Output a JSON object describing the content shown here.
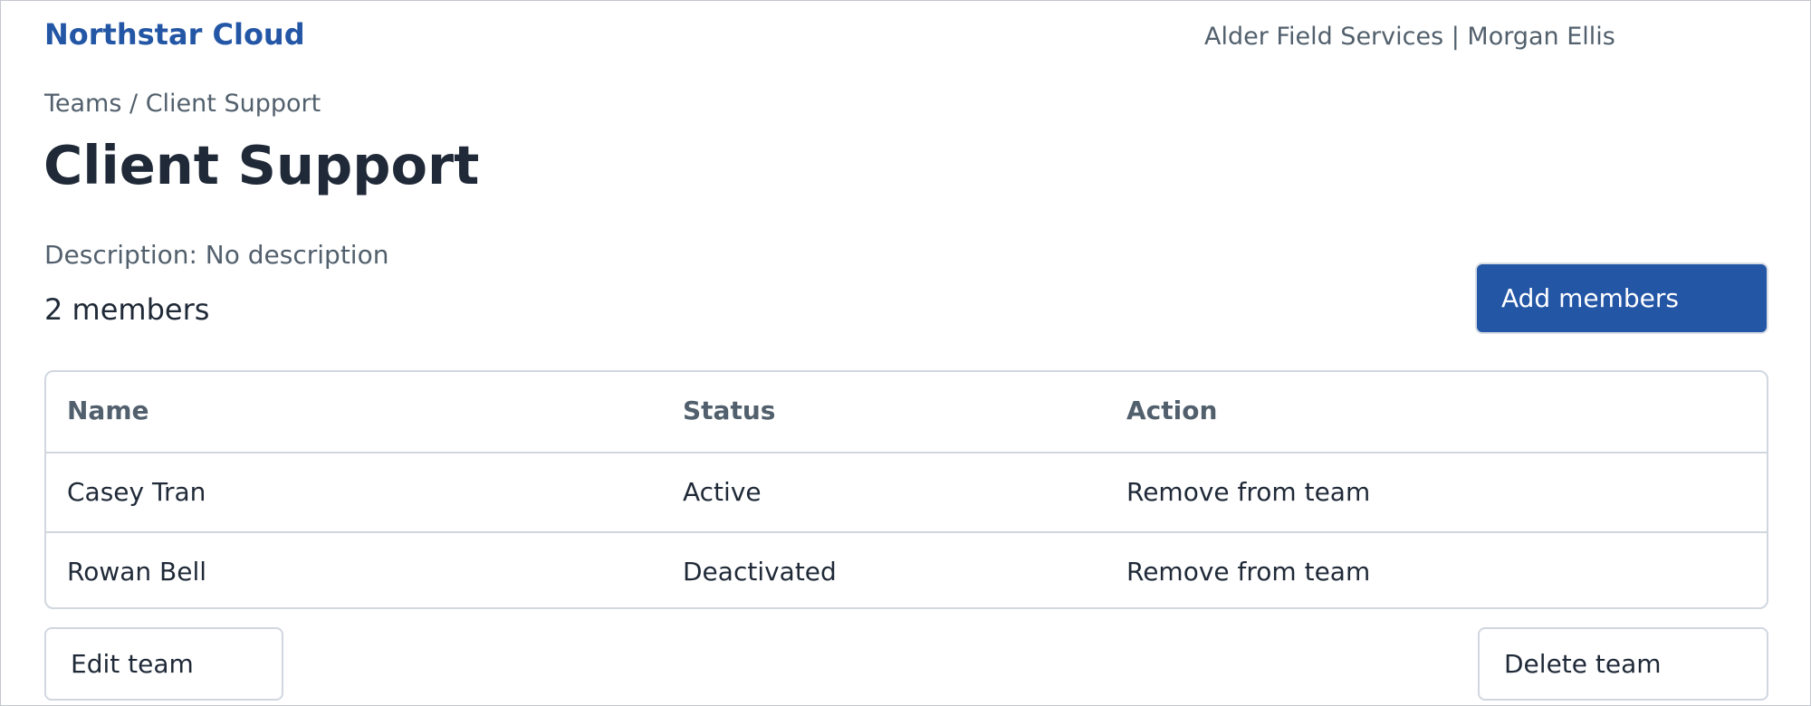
{
  "header": {
    "brand": "Northstar Cloud",
    "account": "Alder Field Services | Morgan Ellis"
  },
  "breadcrumb": "Teams / Client Support",
  "team": {
    "title": "Client Support",
    "description": "Description: No description",
    "member_count": "2 members"
  },
  "actions": {
    "add_members": "Add members",
    "edit_team": "Edit team",
    "delete_team": "Delete team"
  },
  "table": {
    "columns": [
      "Name",
      "Status",
      "Action"
    ],
    "rows": [
      {
        "name": "Casey Tran",
        "status": "Active",
        "action": "Remove from team"
      },
      {
        "name": "Rowan Bell",
        "status": "Deactivated",
        "action": "Remove from team"
      }
    ]
  },
  "colors": {
    "brand": "#2456a6",
    "text": "#1f2937",
    "muted": "#52606d",
    "border": "#d1d7df"
  }
}
